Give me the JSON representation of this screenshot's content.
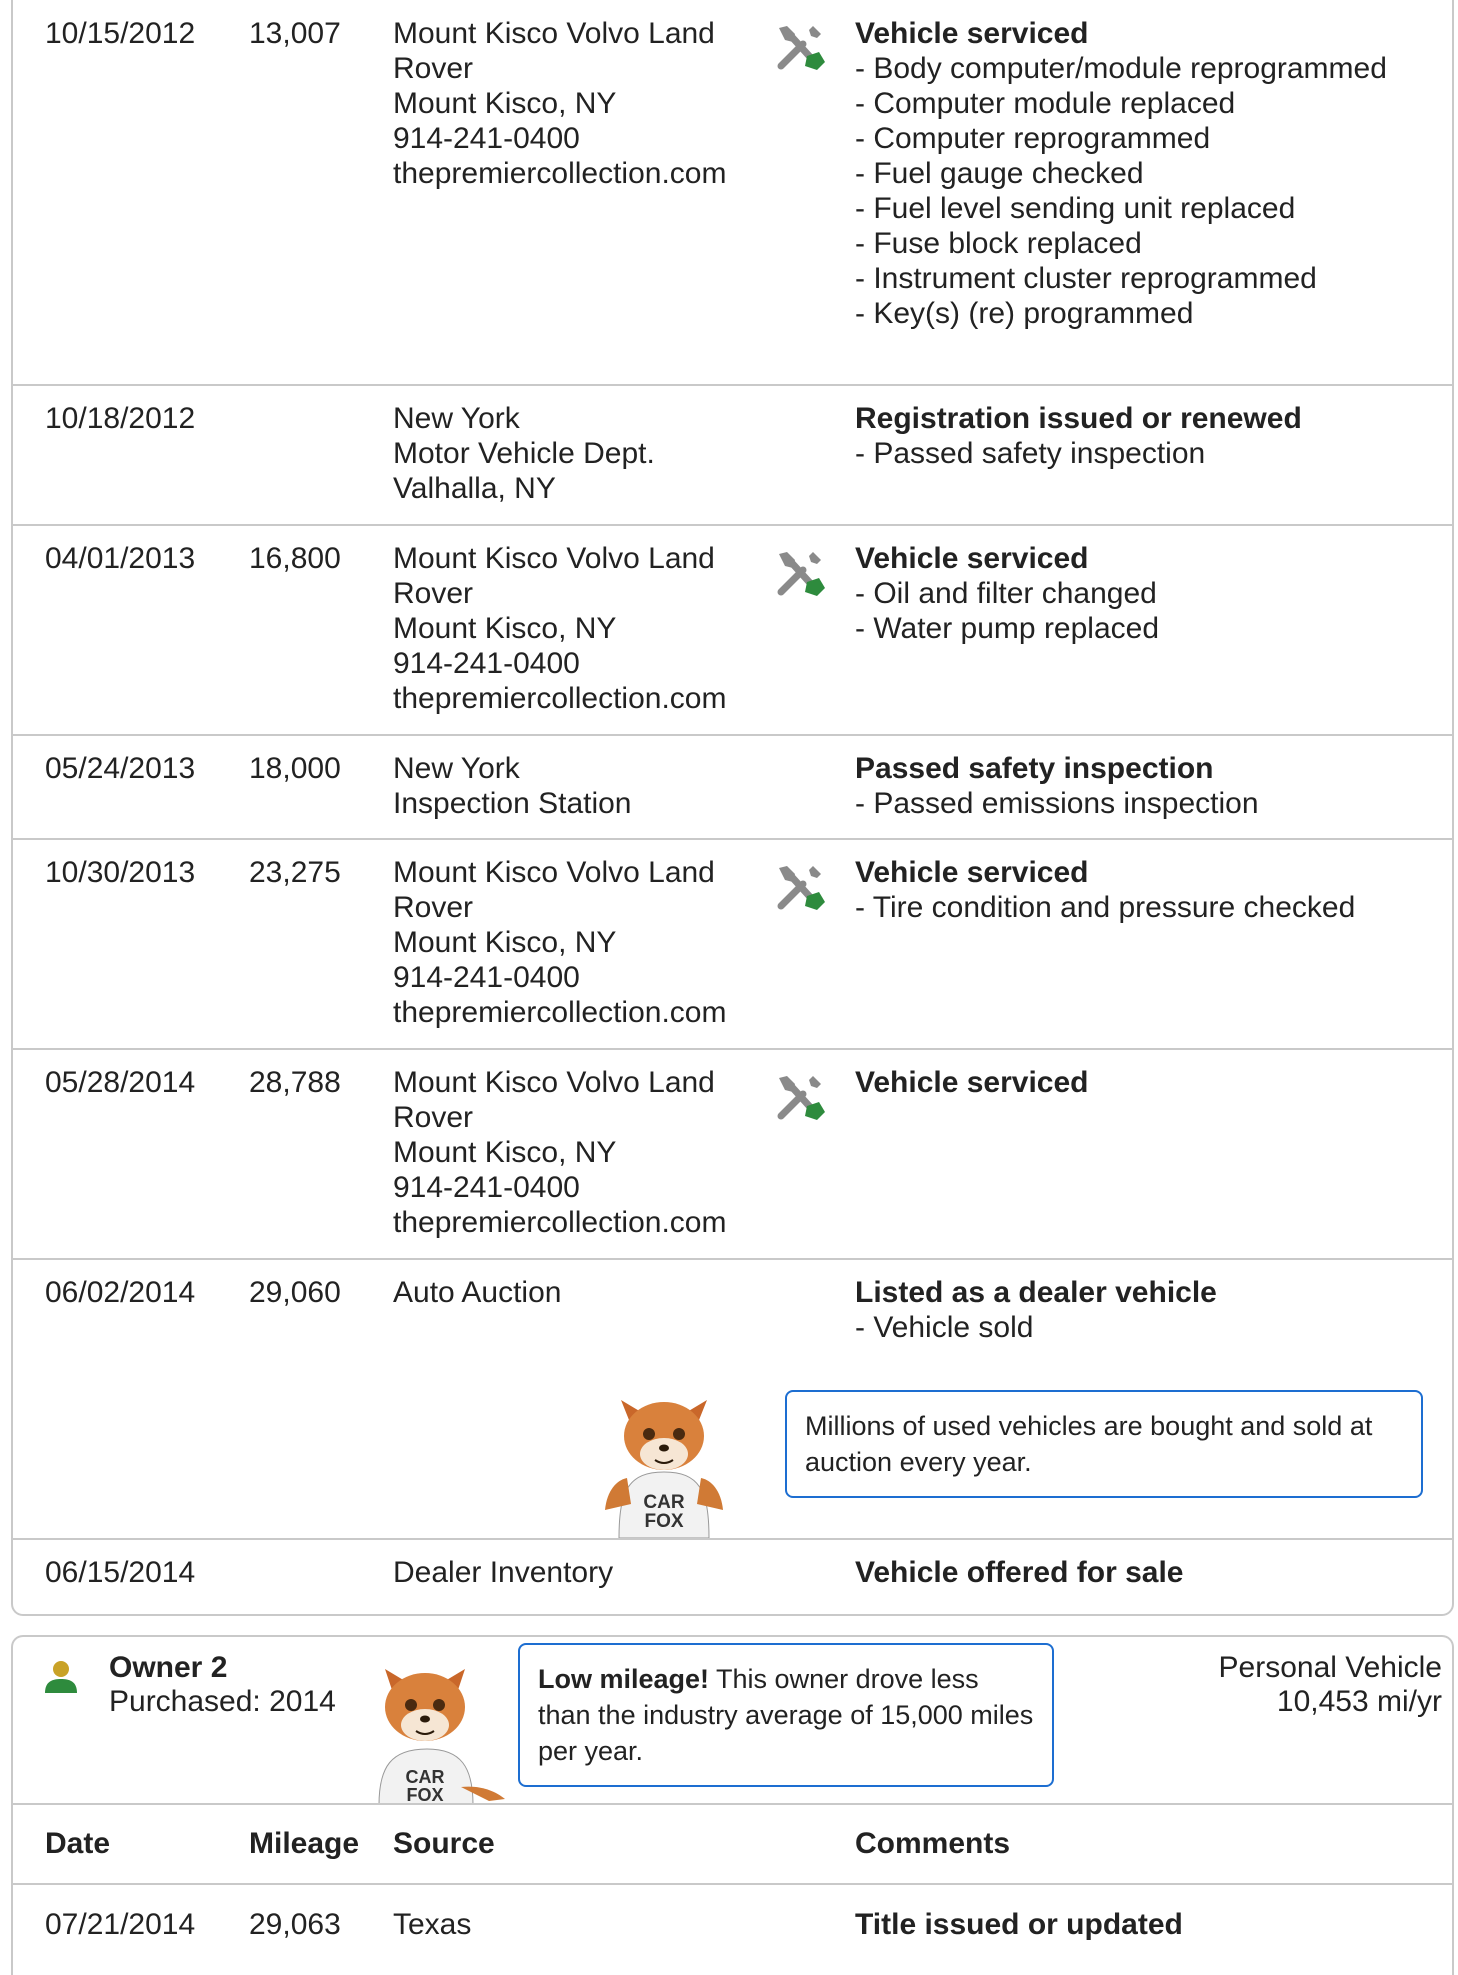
{
  "history_1": {
    "rows": [
      {
        "date": "10/15/2012",
        "mileage": "13,007",
        "source": [
          "Mount Kisco Volvo Land",
          "Rover",
          "Mount Kisco, NY",
          "914-241-0400",
          "thepremiercollection.com"
        ],
        "icon": "service-wrench-icon",
        "title": "Vehicle serviced",
        "items": [
          "Body computer/module reprogrammed",
          "Computer module replaced",
          "Computer reprogrammed",
          "Fuel gauge checked",
          "Fuel level sending unit replaced",
          "Fuse block replaced",
          "Instrument cluster reprogrammed",
          "Key(s) (re) programmed"
        ]
      },
      {
        "date": "10/18/2012",
        "mileage": "",
        "source": [
          "New York",
          "Motor Vehicle Dept.",
          "Valhalla, NY"
        ],
        "icon": "",
        "title": "Registration issued or renewed",
        "items": [
          "Passed safety inspection"
        ]
      },
      {
        "date": "04/01/2013",
        "mileage": "16,800",
        "source": [
          "Mount Kisco Volvo Land",
          "Rover",
          "Mount Kisco, NY",
          "914-241-0400",
          "thepremiercollection.com"
        ],
        "icon": "service-wrench-icon",
        "title": "Vehicle serviced",
        "items": [
          "Oil and filter changed",
          "Water pump replaced"
        ]
      },
      {
        "date": "05/24/2013",
        "mileage": "18,000",
        "source": [
          "New York",
          "Inspection Station"
        ],
        "icon": "",
        "title": "Passed safety inspection",
        "items": [
          "Passed emissions inspection"
        ]
      },
      {
        "date": "10/30/2013",
        "mileage": "23,275",
        "source": [
          "Mount Kisco Volvo Land",
          "Rover",
          "Mount Kisco, NY",
          "914-241-0400",
          "thepremiercollection.com"
        ],
        "icon": "service-wrench-icon",
        "title": "Vehicle serviced",
        "items": [
          "Tire condition and pressure checked"
        ]
      },
      {
        "date": "05/28/2014",
        "mileage": "28,788",
        "source": [
          "Mount Kisco Volvo Land",
          "Rover",
          "Mount Kisco, NY",
          "914-241-0400",
          "thepremiercollection.com"
        ],
        "icon": "service-wrench-icon",
        "title": "Vehicle serviced",
        "items": []
      },
      {
        "date": "06/02/2014",
        "mileage": "29,060",
        "source": [
          "Auto Auction"
        ],
        "icon": "",
        "title": "Listed as a dealer vehicle",
        "items": [
          "Vehicle sold"
        ]
      },
      {
        "date": "06/15/2014",
        "mileage": "",
        "source": [
          "Dealer Inventory"
        ],
        "icon": "",
        "title": "Vehicle offered for sale",
        "items": []
      }
    ],
    "auction_tip": "Millions of used vehicles are bought and sold at auction every year."
  },
  "owner_2": {
    "name": "Owner 2",
    "purchased": "Purchased: 2014",
    "tip_bold": "Low mileage!",
    "tip_text": " This owner drove less than the industry average of 15,000 miles per year.",
    "type": "Personal Vehicle",
    "miles_per_year": "10,453 mi/yr",
    "headers": {
      "date": "Date",
      "mileage": "Mileage",
      "source": "Source",
      "comments": "Comments"
    },
    "rows": [
      {
        "date": "07/21/2014",
        "mileage": "29,063",
        "source": "Texas",
        "title": "Title issued or updated"
      }
    ]
  },
  "fox_shirt": "CAR FOX",
  "colors": {
    "border": "#c9c9c9",
    "bubble": "#1d6ed1",
    "wrench_gray": "#8a8a8a",
    "wrench_green": "#2e8b3d",
    "owner_icon_gold": "#c9a227",
    "owner_icon_green": "#2e8b3d"
  }
}
